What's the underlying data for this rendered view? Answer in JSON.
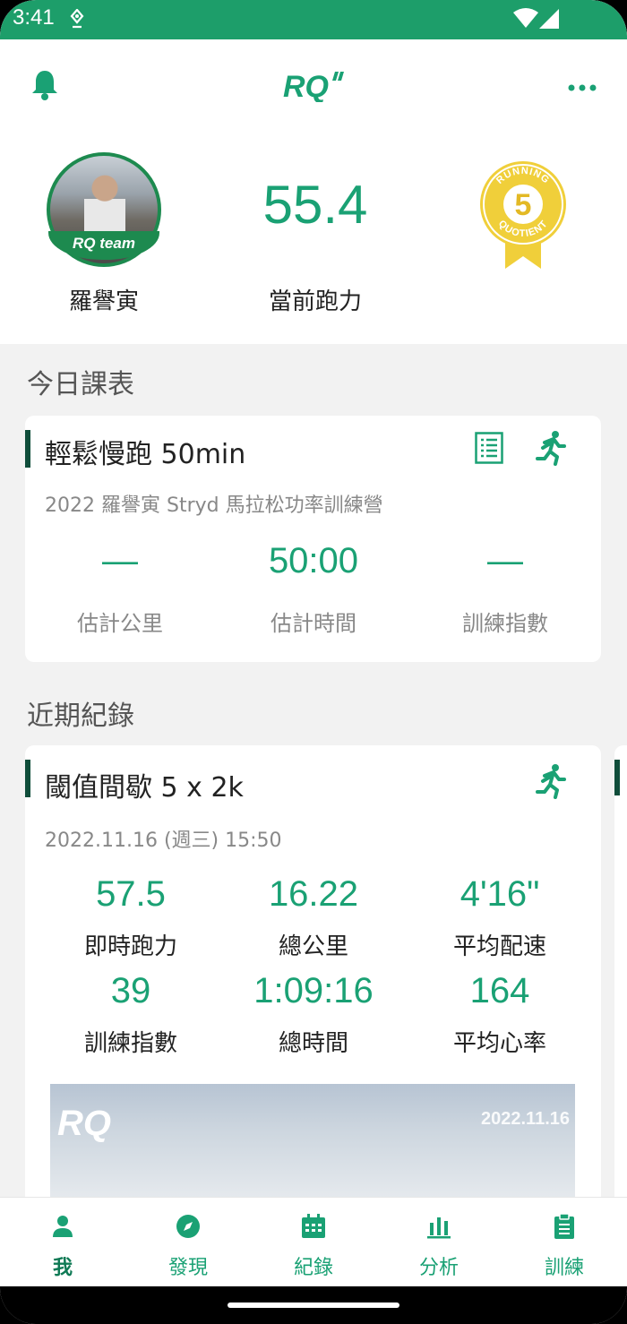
{
  "status_bar": {
    "time": "3:41"
  },
  "app_bar": {
    "logo_text": "RQ\""
  },
  "profile": {
    "name": "羅譽寅",
    "badge": "RQ team",
    "power_value": "55.4",
    "power_label": "當前跑力",
    "medal_top": "RUNNING",
    "medal_bottom": "QUOTIENT",
    "medal_number": "5"
  },
  "today": {
    "section_title": "今日課表",
    "card": {
      "title": "輕鬆慢跑 50min",
      "subtitle": "2022 羅譽寅 Stryd 馬拉松功率訓練營",
      "stats": [
        {
          "value": "—",
          "label": "估計公里"
        },
        {
          "value": "50:00",
          "label": "估計時間"
        },
        {
          "value": "—",
          "label": "訓練指數"
        }
      ]
    }
  },
  "recent": {
    "section_title": "近期紀錄",
    "card": {
      "title": "閾值間歇 5 x 2k",
      "datetime": "2022.11.16 (週三) 15:50",
      "stats": [
        {
          "value": "57.5",
          "label": "即時跑力"
        },
        {
          "value": "16.22",
          "label": "總公里"
        },
        {
          "value": "4'16\"",
          "label": "平均配速"
        },
        {
          "value": "39",
          "label": "訓練指數"
        },
        {
          "value": "1:09:16",
          "label": "總時間"
        },
        {
          "value": "164",
          "label": "平均心率"
        }
      ],
      "photo_logo": "RQ",
      "photo_date": "2022.11.16"
    }
  },
  "nav": [
    {
      "label": "我",
      "icon": "person-icon",
      "active": true
    },
    {
      "label": "發現",
      "icon": "compass-icon",
      "active": false
    },
    {
      "label": "紀錄",
      "icon": "calendar-icon",
      "active": false
    },
    {
      "label": "分析",
      "icon": "bar-chart-icon",
      "active": false
    },
    {
      "label": "訓練",
      "icon": "clipboard-icon",
      "active": false
    }
  ],
  "colors": {
    "accent": "#1aa174",
    "status_bar": "#1d9e6a",
    "card_bar": "#0f4d3a"
  }
}
